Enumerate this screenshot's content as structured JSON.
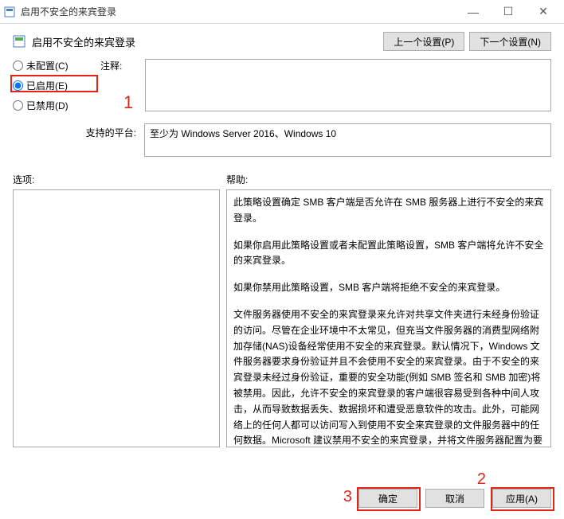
{
  "window": {
    "title": "启用不安全的来宾登录",
    "minimize": "—",
    "maximize": "☐",
    "close": "✕"
  },
  "header": {
    "title": "启用不安全的来宾登录",
    "prev_btn": "上一个设置(P)",
    "next_btn": "下一个设置(N)"
  },
  "radios": {
    "not_configured": "未配置(C)",
    "enabled": "已启用(E)",
    "disabled": "已禁用(D)"
  },
  "comment": {
    "label": "注释:"
  },
  "platforms": {
    "label": "支持的平台:",
    "value": "至少为 Windows Server 2016、Windows 10"
  },
  "sections": {
    "options": "选项:",
    "help": "帮助:"
  },
  "help_text": {
    "p1": "此策略设置确定 SMB 客户端是否允许在 SMB 服务器上进行不安全的来宾登录。",
    "p2": "如果你启用此策略设置或者未配置此策略设置，SMB 客户端将允许不安全的来宾登录。",
    "p3": "如果你禁用此策略设置，SMB 客户端将拒绝不安全的来宾登录。",
    "p4": "文件服务器使用不安全的来宾登录来允许对共享文件夹进行未经身份验证的访问。尽管在企业环境中不太常见，但充当文件服务器的消费型网络附加存储(NAS)设备经常使用不安全的来宾登录。默认情况下，Windows 文件服务器要求身份验证并且不会使用不安全的来宾登录。由于不安全的来宾登录未经过身份验证，重要的安全功能(例如 SMB 签名和 SMB 加密)将被禁用。因此，允许不安全的来宾登录的客户端很容易受到各种中间人攻击，从而导致数据丢失、数据损坏和遭受恶意软件的攻击。此外，可能网络上的任何人都可以访问写入到使用不安全来宾登录的文件服务器中的任何数据。Microsoft 建议禁用不安全的来宾登录，并将文件服务器配置为要求经过身份验证的访问。"
  },
  "footer": {
    "ok": "确定",
    "cancel": "取消",
    "apply": "应用(A)"
  },
  "annotations": {
    "a1": "1",
    "a2": "2",
    "a3": "3"
  }
}
